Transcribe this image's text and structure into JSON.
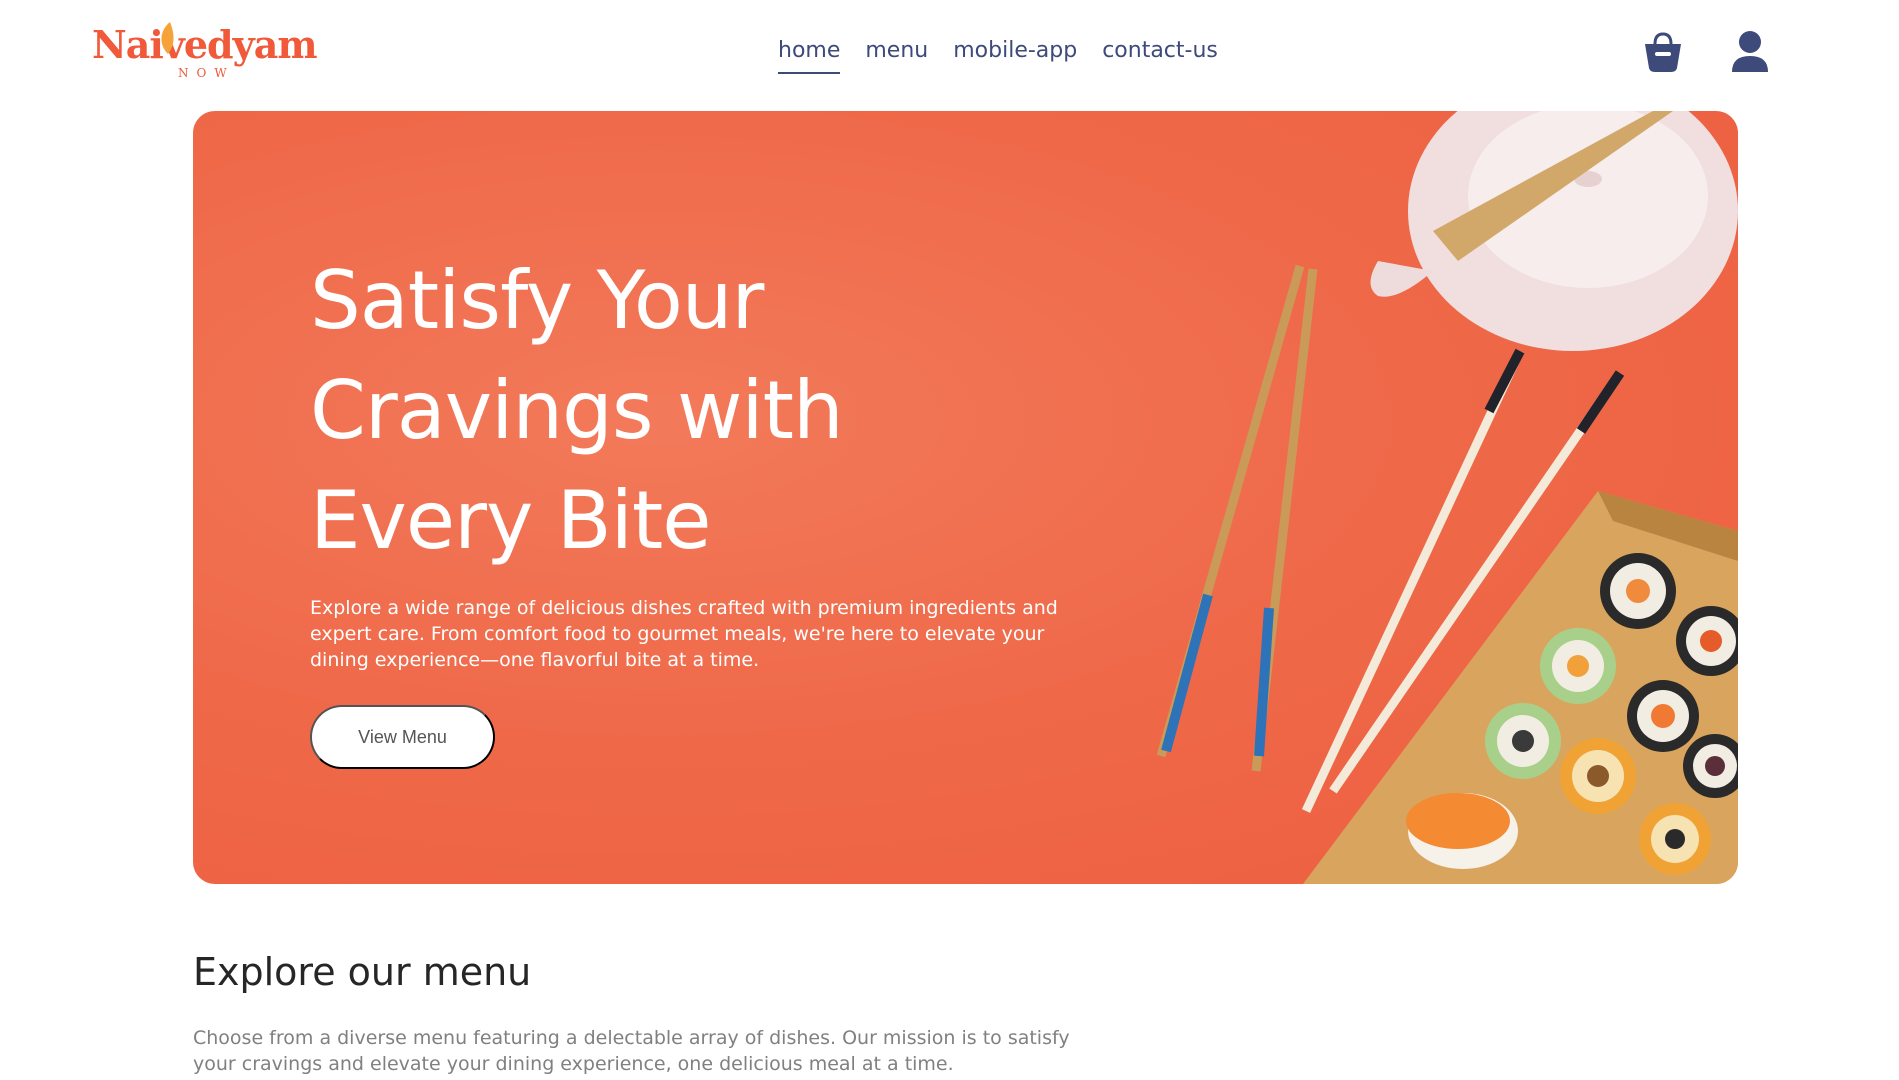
{
  "brand": {
    "name": "Naivedyam",
    "tagline": "NOW",
    "color": "#f0593a"
  },
  "nav": {
    "links": [
      {
        "label": "home",
        "active": true
      },
      {
        "label": "menu",
        "active": false
      },
      {
        "label": "mobile-app",
        "active": false
      },
      {
        "label": "contact-us",
        "active": false
      }
    ],
    "icons": {
      "cart": "basket-icon",
      "profile": "user-icon"
    },
    "color": "#3d4a7a"
  },
  "hero": {
    "title": "Satisfy Your Cravings with Every Bite",
    "description": "Explore a wide range of delicious dishes crafted with premium ingredients and expert care. From comfort food to gourmet meals, we're here to elevate your dining experience—one flavorful bite at a time.",
    "button_label": "View Menu",
    "background": "#ef6a4a"
  },
  "explore": {
    "title": "Explore our menu",
    "description": "Choose from a diverse menu featuring a delectable array of dishes. Our mission is to satisfy your cravings and elevate your dining experience, one delicious meal at a time."
  }
}
